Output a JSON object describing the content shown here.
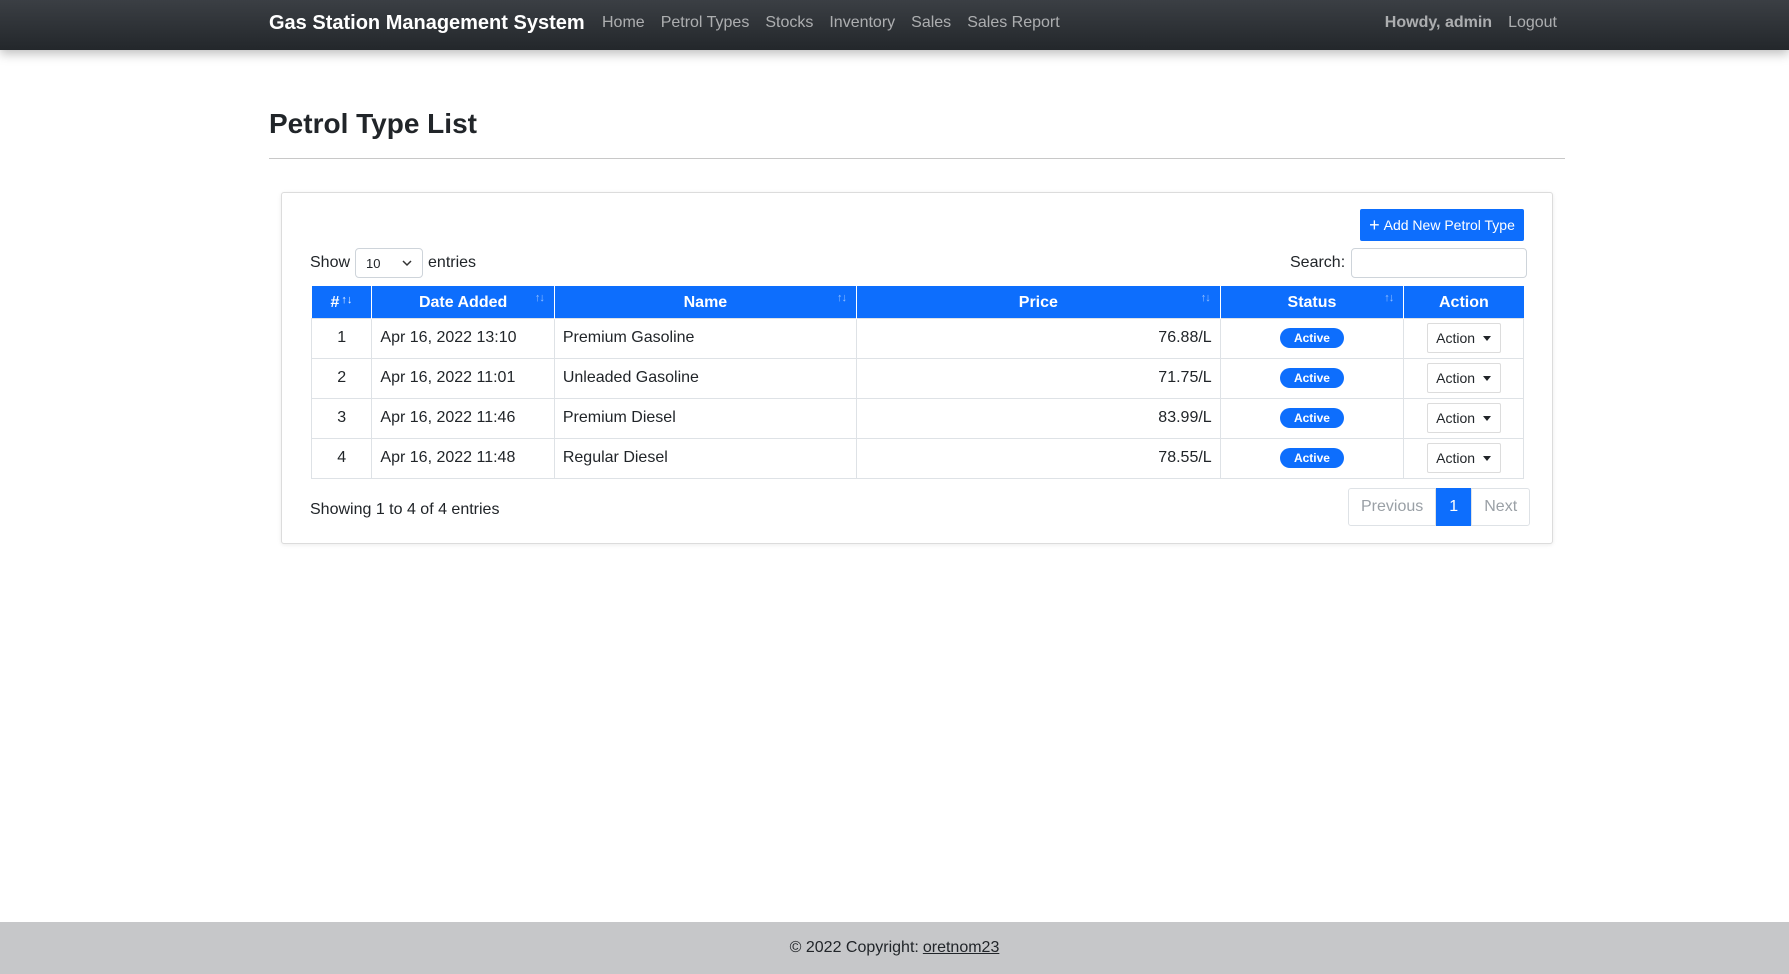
{
  "navbar": {
    "brand": "Gas Station Management System",
    "links": [
      "Home",
      "Petrol Types",
      "Stocks",
      "Inventory",
      "Sales",
      "Sales Report"
    ],
    "howdy": "Howdy, admin",
    "logout": "Logout"
  },
  "page": {
    "title": "Petrol Type List"
  },
  "toolbar": {
    "add_label": "Add New Petrol Type",
    "add_icon": "plus-icon"
  },
  "list_controls": {
    "show_label": "Show",
    "entries_value": "10",
    "entries_label": "entries",
    "search_label": "Search:",
    "search_value": ""
  },
  "table": {
    "columns": [
      "#",
      "Date Added",
      "Name",
      "Price",
      "Status",
      "Action"
    ],
    "rows": [
      {
        "num": "1",
        "date": "Apr 16, 2022 13:10",
        "name": "Premium Gasoline",
        "price": "76.88/L",
        "status": "Active",
        "action": "Action"
      },
      {
        "num": "2",
        "date": "Apr 16, 2022 11:01",
        "name": "Unleaded Gasoline",
        "price": "71.75/L",
        "status": "Active",
        "action": "Action"
      },
      {
        "num": "3",
        "date": "Apr 16, 2022 11:46",
        "name": "Premium Diesel",
        "price": "83.99/L",
        "status": "Active",
        "action": "Action"
      },
      {
        "num": "4",
        "date": "Apr 16, 2022 11:48",
        "name": "Regular Diesel",
        "price": "78.55/L",
        "status": "Active",
        "action": "Action"
      }
    ]
  },
  "pagination": {
    "info": "Showing 1 to 4 of 4 entries",
    "previous": "Previous",
    "current": "1",
    "next": "Next"
  },
  "footer": {
    "copyright": "© 2022 Copyright:",
    "author": "oretnom23"
  },
  "colors": {
    "primary": "#0d6efd",
    "navbar": "#343a40",
    "footer": "#c6c7c9"
  }
}
